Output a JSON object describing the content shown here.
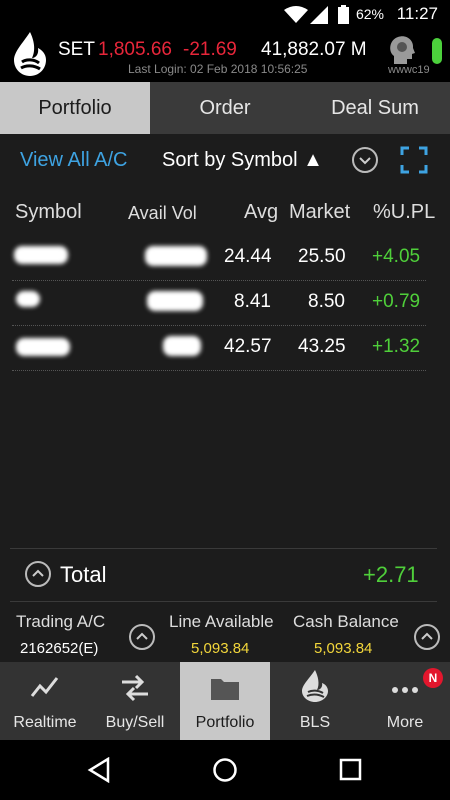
{
  "status_bar": {
    "battery": "62%",
    "time": "11:27"
  },
  "header": {
    "index_name": "SET",
    "index_value": "1,805.66",
    "index_change": "-21.69",
    "market_value": "41,882.07 M",
    "last_login": "Last Login: 02 Feb 2018 10:56:25",
    "user_id": "wwwc19"
  },
  "tabs": [
    {
      "label": "Portfolio",
      "active": true
    },
    {
      "label": "Order",
      "active": false
    },
    {
      "label": "Deal Sum",
      "active": false
    }
  ],
  "toolbar": {
    "view_all": "View All A/C",
    "sort_by": "Sort by Symbol ▲"
  },
  "table": {
    "headers": [
      "Symbol",
      "Avail Vol",
      "Avg",
      "Market",
      "%U.PL"
    ],
    "rows": [
      {
        "avg": "24.44",
        "market": "25.50",
        "upl": "+4.05"
      },
      {
        "avg": "8.41",
        "market": "8.50",
        "upl": "+0.79"
      },
      {
        "avg": "42.57",
        "market": "43.25",
        "upl": "+1.32"
      }
    ]
  },
  "total": {
    "label": "Total",
    "value": "+2.71"
  },
  "account": {
    "trading_label": "Trading A/C",
    "trading_value": "2162652(E)",
    "line_label": "Line Available",
    "line_value": "5,093.84",
    "cash_label": "Cash Balance",
    "cash_value": "5,093.84"
  },
  "nav": [
    {
      "label": "Realtime",
      "icon": "chart-line-icon"
    },
    {
      "label": "Buy/Sell",
      "icon": "transfer-arrows-icon"
    },
    {
      "label": "Portfolio",
      "icon": "folder-icon",
      "active": true
    },
    {
      "label": "BLS",
      "icon": "bls-logo-icon"
    },
    {
      "label": "More",
      "icon": "more-dots-icon",
      "badge": "N"
    }
  ],
  "colors": {
    "accent_blue": "#3ea3e2",
    "negative": "#e8263a",
    "positive": "#4fcf3a",
    "highlight": "#f2d63b"
  }
}
